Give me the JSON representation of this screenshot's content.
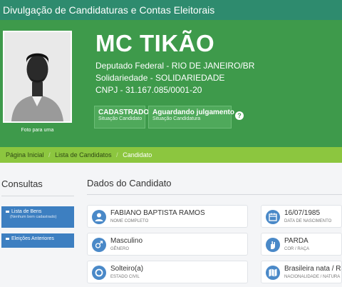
{
  "header": {
    "title": "Divulgação de Candidaturas e Contas Eleitorais"
  },
  "candidate": {
    "photo_caption": "Foto para urna",
    "name": "MC TIKÃO",
    "office": "Deputado Federal - RIO DE JANEIRO/BR",
    "party": "Solidariedade - SOLIDARIEDADE",
    "cnpj": "CNPJ - 31.167.085/0001-20",
    "status": [
      {
        "value": "CADASTRADO",
        "label": "Situação Candidato"
      },
      {
        "value": "Aguardando julgamento",
        "label": "Situação Candidatura"
      }
    ],
    "help_icon": "?"
  },
  "breadcrumb": {
    "items": [
      "Página Inicial",
      "Lista de Candidatos",
      "Candidato"
    ],
    "separator": "/"
  },
  "sidebar": {
    "title": "Consultas",
    "buttons": [
      {
        "label": "Lista de Bens",
        "sub": "(Nenhum bem cadastrado)"
      },
      {
        "label": "Eleições Anteriores"
      }
    ]
  },
  "main": {
    "title": "Dados do Candidato",
    "fields": [
      {
        "value": "FABIANO BAPTISTA RAMOS",
        "label": "NOME COMPLETO",
        "icon": "user-icon"
      },
      {
        "value": "16/07/1985",
        "label": "DATA DE NASCIMENTO",
        "icon": "calendar-icon"
      },
      {
        "value": "Masculino",
        "label": "GÊNERO",
        "icon": "gender-icon"
      },
      {
        "value": "PARDA",
        "label": "COR / RAÇA",
        "icon": "hand-icon"
      },
      {
        "value": "Solteiro(a)",
        "label": "ESTADO CIVIL",
        "icon": "ring-icon"
      },
      {
        "value": "Brasileira nata / RJ-",
        "label": "NACIONALIDADE / NATURA",
        "icon": "map-icon"
      }
    ]
  }
}
